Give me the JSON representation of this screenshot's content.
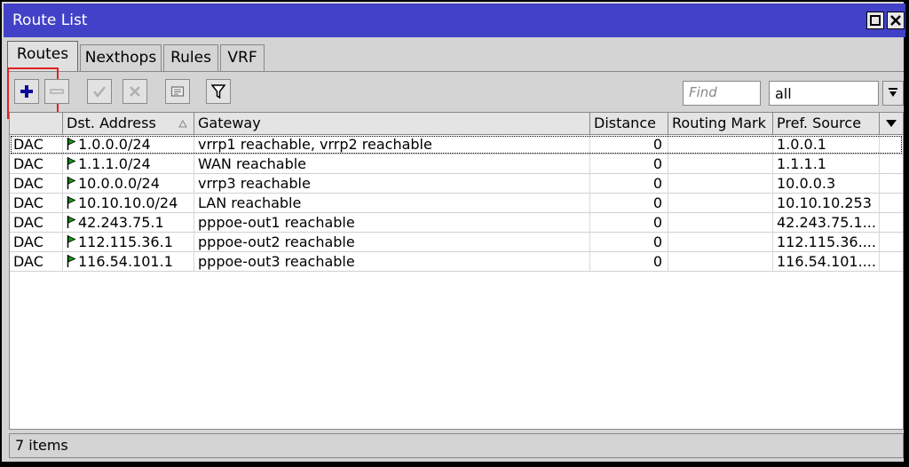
{
  "window": {
    "title": "Route List"
  },
  "tabs": [
    {
      "label": "Routes"
    },
    {
      "label": "Nexthops"
    },
    {
      "label": "Rules"
    },
    {
      "label": "VRF"
    }
  ],
  "toolbar": {
    "find_placeholder": "Find",
    "filter_value": "all"
  },
  "columns": [
    "",
    "Dst. Address",
    "Gateway",
    "Distance",
    "Routing Mark",
    "Pref. Source"
  ],
  "rows": [
    {
      "flags": "DAC",
      "dst": "1.0.0.0/24",
      "gateway": "vrrp1 reachable, vrrp2 reachable",
      "distance": "0",
      "mark": "",
      "pref": "1.0.0.1"
    },
    {
      "flags": "DAC",
      "dst": "1.1.1.0/24",
      "gateway": "WAN reachable",
      "distance": "0",
      "mark": "",
      "pref": "1.1.1.1"
    },
    {
      "flags": "DAC",
      "dst": "10.0.0.0/24",
      "gateway": "vrrp3 reachable",
      "distance": "0",
      "mark": "",
      "pref": "10.0.0.3"
    },
    {
      "flags": "DAC",
      "dst": "10.10.10.0/24",
      "gateway": "LAN reachable",
      "distance": "0",
      "mark": "",
      "pref": "10.10.10.253"
    },
    {
      "flags": "DAC",
      "dst": "42.243.75.1",
      "gateway": "pppoe-out1 reachable",
      "distance": "0",
      "mark": "",
      "pref": "42.243.75.1..."
    },
    {
      "flags": "DAC",
      "dst": "112.115.36.1",
      "gateway": "pppoe-out2 reachable",
      "distance": "0",
      "mark": "",
      "pref": "112.115.36...."
    },
    {
      "flags": "DAC",
      "dst": "116.54.101.1",
      "gateway": "pppoe-out3 reachable",
      "distance": "0",
      "mark": "",
      "pref": "116.54.101...."
    }
  ],
  "status": {
    "text": "7 items"
  },
  "colors": {
    "titlebar": "#4242c8",
    "add_icon": "#0a0a9a",
    "flag": "#10a010",
    "highlight": "#e02020"
  },
  "icons": [
    "add-icon",
    "remove-icon",
    "enable-icon",
    "disable-icon",
    "comment-icon",
    "filter-icon",
    "dropdown-arrow-icon",
    "sort-arrow-icon",
    "route-flag-icon"
  ]
}
